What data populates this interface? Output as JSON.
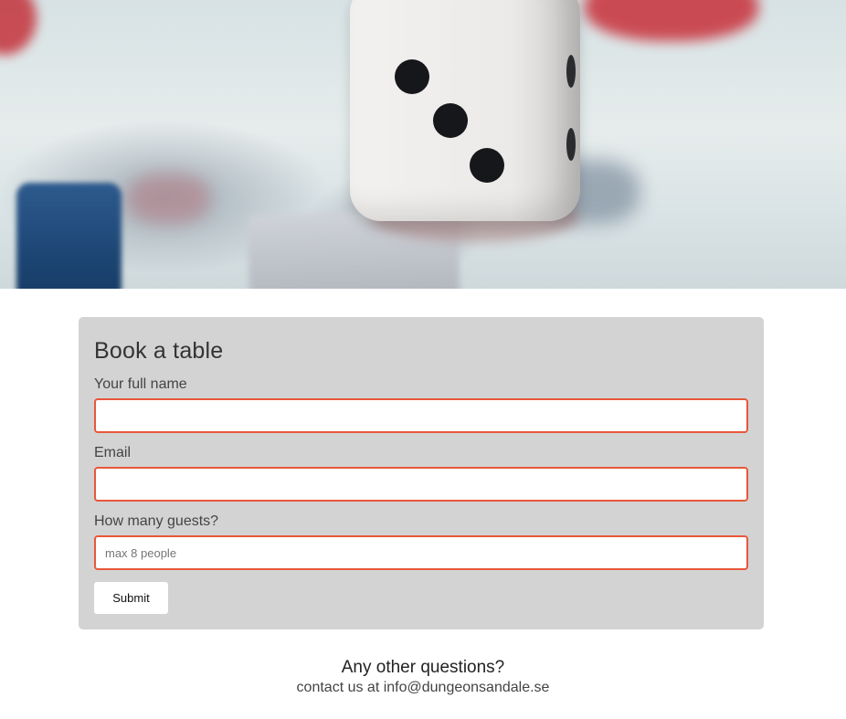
{
  "hero": {
    "image_alt": "dice-on-game-board-photo"
  },
  "booking": {
    "title": "Book a table",
    "name_label": "Your full name",
    "name_value": "",
    "name_placeholder": "",
    "email_label": "Email",
    "email_value": "",
    "email_placeholder": "",
    "guests_label": "How many guests?",
    "guests_value": "",
    "guests_placeholder": "max 8 people",
    "submit_label": "Submit"
  },
  "contact": {
    "question": "Any other questions?",
    "prefix": "contact us at ",
    "email": "info@dungeonsandale.se"
  },
  "colors": {
    "panel_bg": "#d3d3d3",
    "input_border": "#e8573a"
  }
}
